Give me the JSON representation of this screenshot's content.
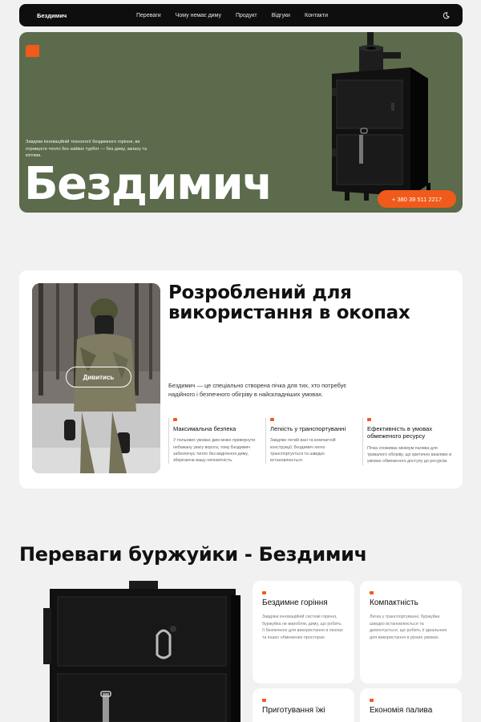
{
  "nav": {
    "brand": "Бездимич",
    "links": [
      "Переваги",
      "Чому немає диму",
      "Продукт",
      "Відгуки",
      "Контакти"
    ]
  },
  "hero": {
    "text": "Завдяки інноваційній технології бездимного горіння, ви отримуєте тепло без зайвих турбот — без диму, запаху та кіптяви.",
    "title": "Бездимич",
    "phone": "+ 380 39 511 2217"
  },
  "section2": {
    "watch_label": "Дивитись",
    "title": "Розроблений для використання в окопах",
    "description": "Бездимич — це спеціально створена пічка для тих, хто потребує надійного і безпечного обігріву в найскладніших умовах.",
    "features": [
      {
        "title": "Максимальна безпека",
        "text": "У польових умовах дим може привернути небажану увагу ворога, тому Бездимич забезпечує тепло без виділення диму, зберігаючи вашу непомітність."
      },
      {
        "title": "Легкість у транспортуванні",
        "text": "Завдяки легкій вазі та компактній конструкції, Бездимич легко транспортується та швидко встановлюється."
      },
      {
        "title": "Ефективність в умовах обмеженого ресурсу",
        "text": "Пічка споживає мінімум палива для тривалого обігріву, що критично важливо в умовах обмеженого доступу до ресурсів."
      }
    ]
  },
  "section3": {
    "title": "Переваги буржуйки - Бездимич",
    "cards": [
      {
        "title": "Бездимне горіння",
        "text": "Завдяки інноваційній системі горіння, буржуйка не виробляє диму, що робить її безпечною для використання в окопах та інших обмежених просторах."
      },
      {
        "title": "Компактність",
        "text": "Легка у транспортуванні, буржуйка швидко встановлюється та демонтується, що робить її ідеальною для використання в різних умовах."
      },
      {
        "title": "Приготування їжі",
        "text": ""
      },
      {
        "title": "Економія палива",
        "text": ""
      }
    ]
  },
  "colors": {
    "accent": "#f05a1a",
    "hero_bg": "#5c6b4b",
    "nav_bg": "#0e0e0e"
  },
  "icons": [
    "logo-icon",
    "moon-icon"
  ]
}
